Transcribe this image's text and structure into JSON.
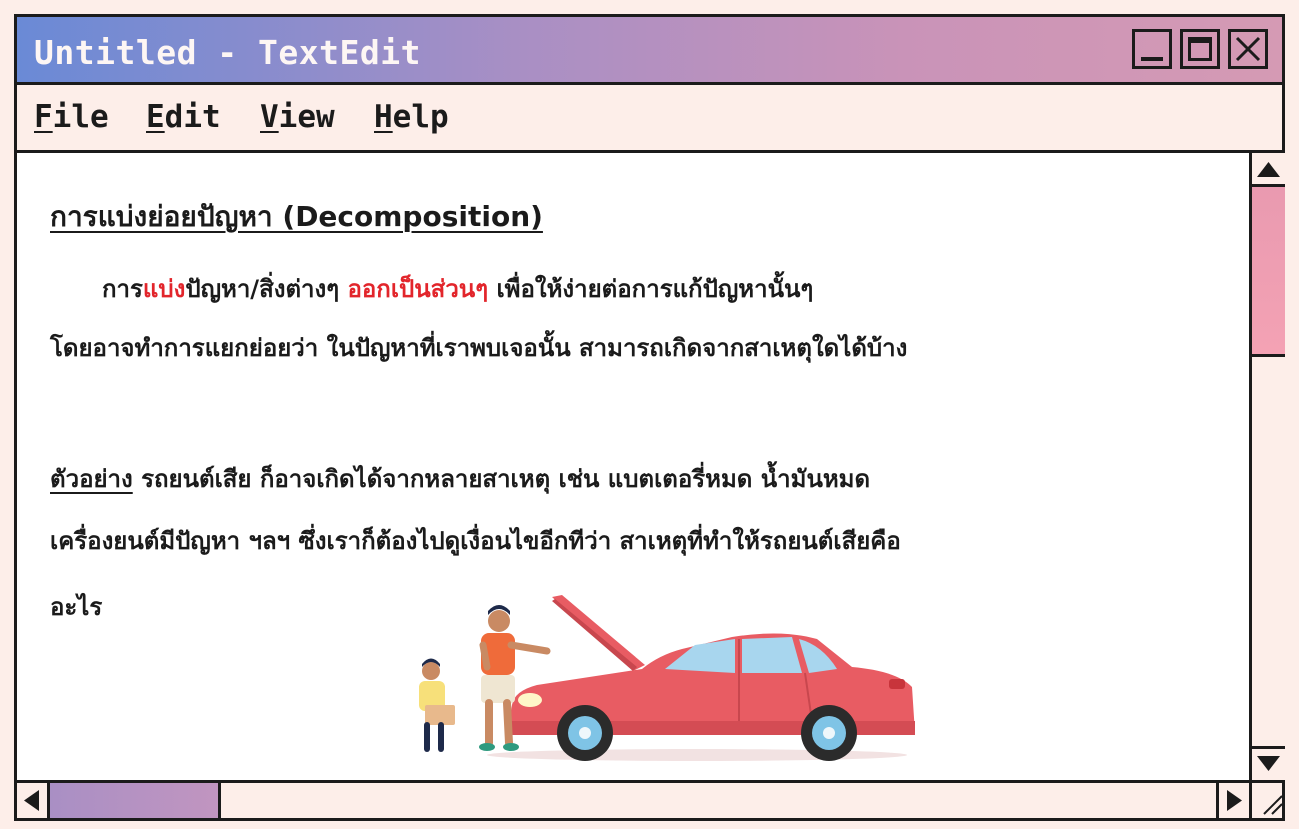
{
  "window": {
    "title": "Untitled - TextEdit",
    "controls": [
      "minimize",
      "maximize",
      "close"
    ]
  },
  "menu": [
    {
      "accel": "F",
      "rest": "ile"
    },
    {
      "accel": "E",
      "rest": "dit"
    },
    {
      "accel": "V",
      "rest": "iew"
    },
    {
      "accel": "H",
      "rest": "elp"
    }
  ],
  "document": {
    "heading": "การแบ่งย่อยปัญหา (Decomposition)",
    "para1": {
      "s1": "การ",
      "s2": "แบ่ง",
      "s3": "ปัญหา/สิ่งต่างๆ ",
      "s4": "ออกเป็นส่วนๆ",
      "s5": " เพื่อให้ง่ายต่อการแก้ปัญหานั้นๆ"
    },
    "line2": "โดยอาจทำการแยกย่อยว่า ในปัญหาที่เราพบเจอนั้น สามารถเกิดจากสาเหตุใดได้บ้าง",
    "example_label": "ตัวอย่าง",
    "line3": " รถยนต์เสีย ก็อาจเกิดได้จากหลายสาเหตุ เช่น แบตเตอรี่หมด น้ำมันหมด",
    "line4": "เครื่องยนต์มีปัญหา ฯลฯ ซึ่งเราก็ต้องไปดูเงื่อนไขอีกทีว่า สาเหตุที่ทำให้รถยนต์เสียคือ",
    "line5": "อะไร"
  },
  "colors": {
    "title_gradient_start": "#6a8ad6",
    "title_gradient_end": "#d59ab4",
    "highlight_red": "#e2252b",
    "window_bg": "#fdeee9",
    "car_red": "#e85c63"
  },
  "icons": {
    "illustration": "man-and-boy-fixing-red-car"
  }
}
